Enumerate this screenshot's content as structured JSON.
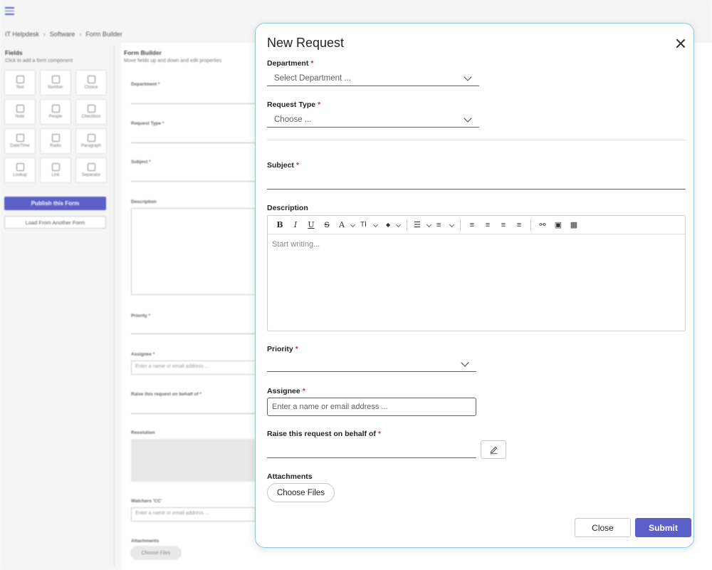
{
  "background": {
    "breadcrumb": [
      "IT Helpdesk",
      "Software",
      "Form Builder"
    ],
    "fields_panel": {
      "title": "Fields",
      "subtitle": "Click to add a form component",
      "components": [
        "Text",
        "Number",
        "Choice",
        "Note",
        "People",
        "Checkbox",
        "Date/Time",
        "Radio",
        "Paragraph",
        "Lookup",
        "Link",
        "Separator"
      ],
      "publish_label": "Publish this Form",
      "load_label": "Load From Another Form"
    },
    "form_builder": {
      "title": "Form Builder",
      "subtitle": "Move fields up and down and edit properties",
      "fields": {
        "department": "Department *",
        "request_type": "Request Type *",
        "subject": "Subject *",
        "description": "Description",
        "priority": "Priority *",
        "assignee": "Assignee *",
        "assignee_placeholder": "Enter a name or email address ...",
        "behalf": "Raise this request on behalf of *",
        "resolution": "Resolution",
        "watchers": "Watchers 'CC'",
        "watchers_placeholder": "Enter a name or email address ...",
        "attachments": "Attachments",
        "choose_files": "Choose Files"
      }
    }
  },
  "dialog": {
    "title": "New Request",
    "required_mark": "*",
    "department": {
      "label": "Department",
      "placeholder": "Select Department ..."
    },
    "request_type": {
      "label": "Request Type",
      "placeholder": "Choose ..."
    },
    "subject": {
      "label": "Subject"
    },
    "description": {
      "label": "Description",
      "placeholder": "Start writing...",
      "toolbar": {
        "bold": "B",
        "italic": "I",
        "underline": "U",
        "strike": "S",
        "font_color": "A",
        "font_size": "TI",
        "highlight": "◆",
        "bullets": "☰",
        "numbered": "≡",
        "align_center": "≡",
        "align_left": "≡",
        "align_right": "≡",
        "justify": "≡",
        "link": "⚯",
        "image": "▣",
        "table": "▦"
      }
    },
    "priority": {
      "label": "Priority"
    },
    "assignee": {
      "label": "Assignee",
      "placeholder": "Enter a name or email address ..."
    },
    "behalf": {
      "label": "Raise this request on behalf of"
    },
    "attachments": {
      "label": "Attachments",
      "button": "Choose Files"
    },
    "footer": {
      "close": "Close",
      "submit": "Submit"
    }
  }
}
